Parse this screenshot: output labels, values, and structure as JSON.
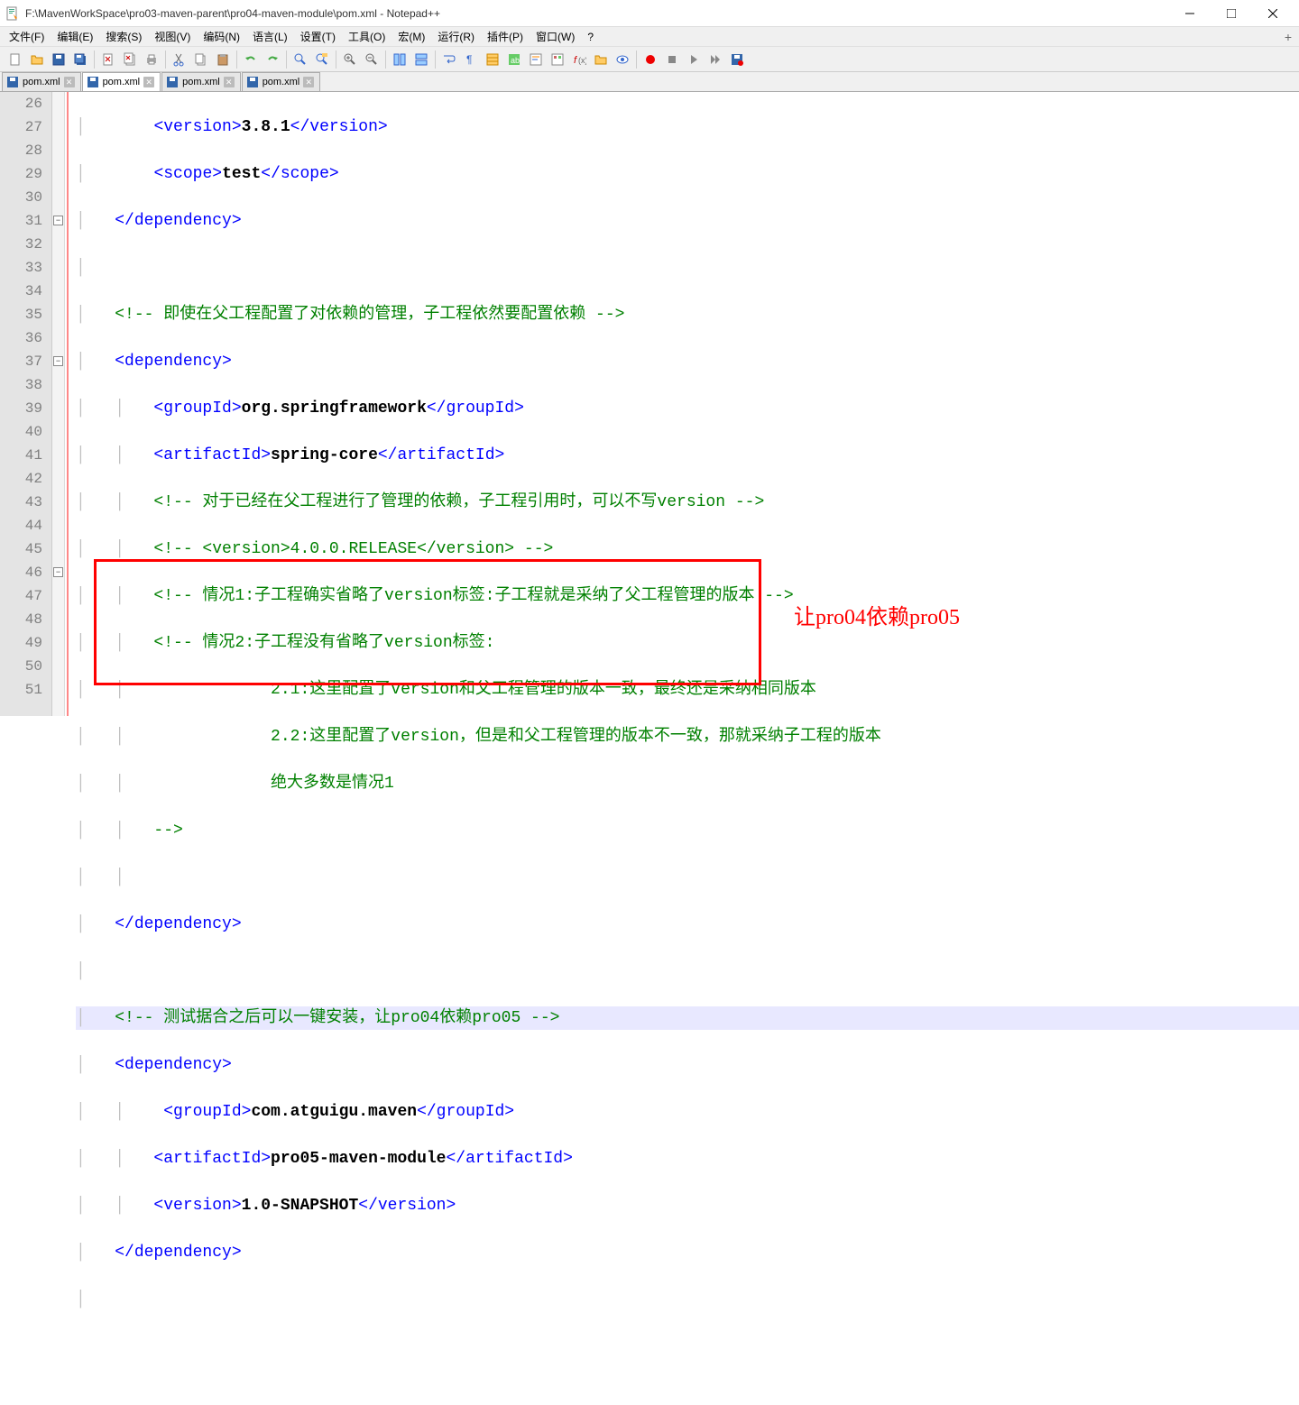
{
  "window": {
    "title": "F:\\MavenWorkSpace\\pro03-maven-parent\\pro04-maven-module\\pom.xml - Notepad++"
  },
  "menu": {
    "file": "文件(F)",
    "edit": "编辑(E)",
    "search": "搜索(S)",
    "view": "视图(V)",
    "encoding": "编码(N)",
    "language": "语言(L)",
    "settings": "设置(T)",
    "tools": "工具(O)",
    "macro": "宏(M)",
    "run": "运行(R)",
    "plugins": "插件(P)",
    "window": "窗口(W)",
    "help": "?"
  },
  "tabs": [
    {
      "label": "pom.xml",
      "active": false
    },
    {
      "label": "pom.xml",
      "active": true
    },
    {
      "label": "pom.xml",
      "active": false
    },
    {
      "label": "pom.xml",
      "active": false
    }
  ],
  "line_numbers": [
    "26",
    "27",
    "28",
    "29",
    "30",
    "31",
    "32",
    "33",
    "34",
    "35",
    "36",
    "37",
    "38",
    "39",
    "40",
    "41",
    "42",
    "43",
    "44",
    "45",
    "46",
    "47",
    "48",
    "49",
    "50",
    "51"
  ],
  "code": {
    "l26": {
      "open": "<version>",
      "val": "3.8.1",
      "close": "</version>"
    },
    "l27": {
      "open": "<scope>",
      "val": "test",
      "close": "</scope>"
    },
    "l28": {
      "close": "</dependency>"
    },
    "l30": {
      "cmt": "<!-- 即使在父工程配置了对依赖的管理，子工程依然要配置依赖 -->"
    },
    "l31": {
      "open": "<dependency>"
    },
    "l32": {
      "open": "<groupId>",
      "val": "org.springframework",
      "close": "</groupId>"
    },
    "l33": {
      "open": "<artifactId>",
      "val": "spring-core",
      "close": "</artifactId>"
    },
    "l34": {
      "cmt": "<!-- 对于已经在父工程进行了管理的依赖，子工程引用时，可以不写version -->"
    },
    "l35": {
      "cmt": "<!-- <version>4.0.0.RELEASE</version> -->"
    },
    "l36": {
      "cmt": "<!-- 情况1:子工程确实省略了version标签:子工程就是采纳了父工程管理的版本 -->"
    },
    "l37": {
      "cmt": "<!-- 情况2:子工程没有省略了version标签:"
    },
    "l38": {
      "cmt": "        2.1:这里配置了version和父工程管理的版本一致，最终还是采纳相同版本"
    },
    "l39": {
      "cmt": "        2.2:这里配置了version，但是和父工程管理的版本不一致，那就采纳子工程的版本"
    },
    "l40": {
      "cmt": "        绝大多数是情况1"
    },
    "l41": {
      "cmt": "-->"
    },
    "l43": {
      "close": "</dependency>"
    },
    "l45": {
      "cmt": "<!-- 测试据合之后可以一键安装，让pro04依赖pro05 -->"
    },
    "l46": {
      "open": "<dependency>"
    },
    "l47": {
      "open": "<groupId>",
      "val": "com.atguigu.maven",
      "close": "</groupId>"
    },
    "l48": {
      "open": "<artifactId>",
      "val": "pro05-maven-module",
      "close": "</artifactId>"
    },
    "l49": {
      "open": "<version>",
      "val": "1.0-SNAPSHOT",
      "close": "</version>"
    },
    "l50": {
      "close": "</dependency>"
    }
  },
  "annotation": "让pro04依赖pro05"
}
